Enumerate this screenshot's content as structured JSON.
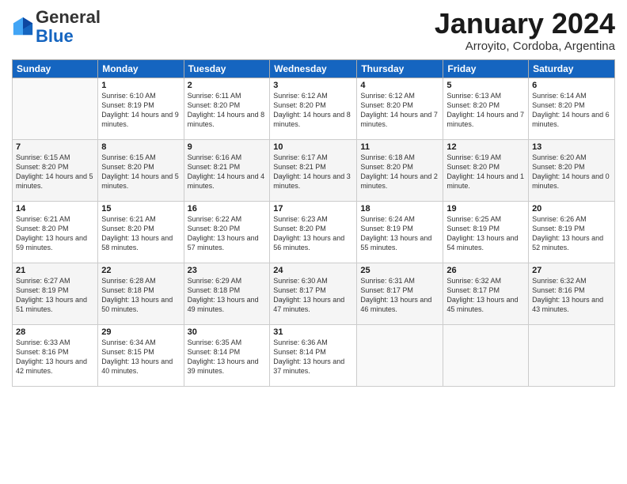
{
  "header": {
    "logo_general": "General",
    "logo_blue": "Blue",
    "month_title": "January 2024",
    "location": "Arroyito, Cordoba, Argentina"
  },
  "weekdays": [
    "Sunday",
    "Monday",
    "Tuesday",
    "Wednesday",
    "Thursday",
    "Friday",
    "Saturday"
  ],
  "weeks": [
    [
      null,
      {
        "day": 1,
        "sunrise": "6:10 AM",
        "sunset": "8:19 PM",
        "daylight": "14 hours and 9 minutes."
      },
      {
        "day": 2,
        "sunrise": "6:11 AM",
        "sunset": "8:20 PM",
        "daylight": "14 hours and 8 minutes."
      },
      {
        "day": 3,
        "sunrise": "6:12 AM",
        "sunset": "8:20 PM",
        "daylight": "14 hours and 8 minutes."
      },
      {
        "day": 4,
        "sunrise": "6:12 AM",
        "sunset": "8:20 PM",
        "daylight": "14 hours and 7 minutes."
      },
      {
        "day": 5,
        "sunrise": "6:13 AM",
        "sunset": "8:20 PM",
        "daylight": "14 hours and 7 minutes."
      },
      {
        "day": 6,
        "sunrise": "6:14 AM",
        "sunset": "8:20 PM",
        "daylight": "14 hours and 6 minutes."
      }
    ],
    [
      {
        "day": 7,
        "sunrise": "6:15 AM",
        "sunset": "8:20 PM",
        "daylight": "14 hours and 5 minutes."
      },
      {
        "day": 8,
        "sunrise": "6:15 AM",
        "sunset": "8:20 PM",
        "daylight": "14 hours and 5 minutes."
      },
      {
        "day": 9,
        "sunrise": "6:16 AM",
        "sunset": "8:21 PM",
        "daylight": "14 hours and 4 minutes."
      },
      {
        "day": 10,
        "sunrise": "6:17 AM",
        "sunset": "8:21 PM",
        "daylight": "14 hours and 3 minutes."
      },
      {
        "day": 11,
        "sunrise": "6:18 AM",
        "sunset": "8:20 PM",
        "daylight": "14 hours and 2 minutes."
      },
      {
        "day": 12,
        "sunrise": "6:19 AM",
        "sunset": "8:20 PM",
        "daylight": "14 hours and 1 minute."
      },
      {
        "day": 13,
        "sunrise": "6:20 AM",
        "sunset": "8:20 PM",
        "daylight": "14 hours and 0 minutes."
      }
    ],
    [
      {
        "day": 14,
        "sunrise": "6:21 AM",
        "sunset": "8:20 PM",
        "daylight": "13 hours and 59 minutes."
      },
      {
        "day": 15,
        "sunrise": "6:21 AM",
        "sunset": "8:20 PM",
        "daylight": "13 hours and 58 minutes."
      },
      {
        "day": 16,
        "sunrise": "6:22 AM",
        "sunset": "8:20 PM",
        "daylight": "13 hours and 57 minutes."
      },
      {
        "day": 17,
        "sunrise": "6:23 AM",
        "sunset": "8:20 PM",
        "daylight": "13 hours and 56 minutes."
      },
      {
        "day": 18,
        "sunrise": "6:24 AM",
        "sunset": "8:19 PM",
        "daylight": "13 hours and 55 minutes."
      },
      {
        "day": 19,
        "sunrise": "6:25 AM",
        "sunset": "8:19 PM",
        "daylight": "13 hours and 54 minutes."
      },
      {
        "day": 20,
        "sunrise": "6:26 AM",
        "sunset": "8:19 PM",
        "daylight": "13 hours and 52 minutes."
      }
    ],
    [
      {
        "day": 21,
        "sunrise": "6:27 AM",
        "sunset": "8:19 PM",
        "daylight": "13 hours and 51 minutes."
      },
      {
        "day": 22,
        "sunrise": "6:28 AM",
        "sunset": "8:18 PM",
        "daylight": "13 hours and 50 minutes."
      },
      {
        "day": 23,
        "sunrise": "6:29 AM",
        "sunset": "8:18 PM",
        "daylight": "13 hours and 49 minutes."
      },
      {
        "day": 24,
        "sunrise": "6:30 AM",
        "sunset": "8:17 PM",
        "daylight": "13 hours and 47 minutes."
      },
      {
        "day": 25,
        "sunrise": "6:31 AM",
        "sunset": "8:17 PM",
        "daylight": "13 hours and 46 minutes."
      },
      {
        "day": 26,
        "sunrise": "6:32 AM",
        "sunset": "8:17 PM",
        "daylight": "13 hours and 45 minutes."
      },
      {
        "day": 27,
        "sunrise": "6:32 AM",
        "sunset": "8:16 PM",
        "daylight": "13 hours and 43 minutes."
      }
    ],
    [
      {
        "day": 28,
        "sunrise": "6:33 AM",
        "sunset": "8:16 PM",
        "daylight": "13 hours and 42 minutes."
      },
      {
        "day": 29,
        "sunrise": "6:34 AM",
        "sunset": "8:15 PM",
        "daylight": "13 hours and 40 minutes."
      },
      {
        "day": 30,
        "sunrise": "6:35 AM",
        "sunset": "8:14 PM",
        "daylight": "13 hours and 39 minutes."
      },
      {
        "day": 31,
        "sunrise": "6:36 AM",
        "sunset": "8:14 PM",
        "daylight": "13 hours and 37 minutes."
      },
      null,
      null,
      null
    ]
  ]
}
